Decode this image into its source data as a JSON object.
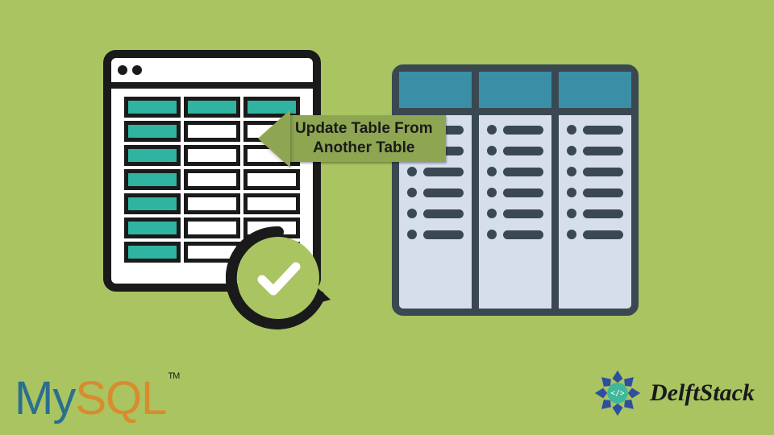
{
  "arrow": {
    "line1": "Update Table From",
    "line2": "Another Table"
  },
  "logos": {
    "mysql_my": "My",
    "mysql_sql": "SQL",
    "mysql_tm": "TM",
    "delftstack": "DelftStack"
  },
  "left_table": {
    "columns": 3,
    "rows": 7,
    "teal_header_row": true,
    "teal_first_column": true
  },
  "right_table": {
    "columns": 3,
    "rows": 6
  },
  "colors": {
    "background": "#a9c461",
    "window_border": "#1a1a1a",
    "teal": "#2fb4a1",
    "right_header": "#3a8fa7",
    "right_body": "#d6deeb",
    "right_border": "#3a4852",
    "arrow": "#8ea652",
    "mysql_blue": "#2a6f8f",
    "mysql_orange": "#d98b2e"
  }
}
